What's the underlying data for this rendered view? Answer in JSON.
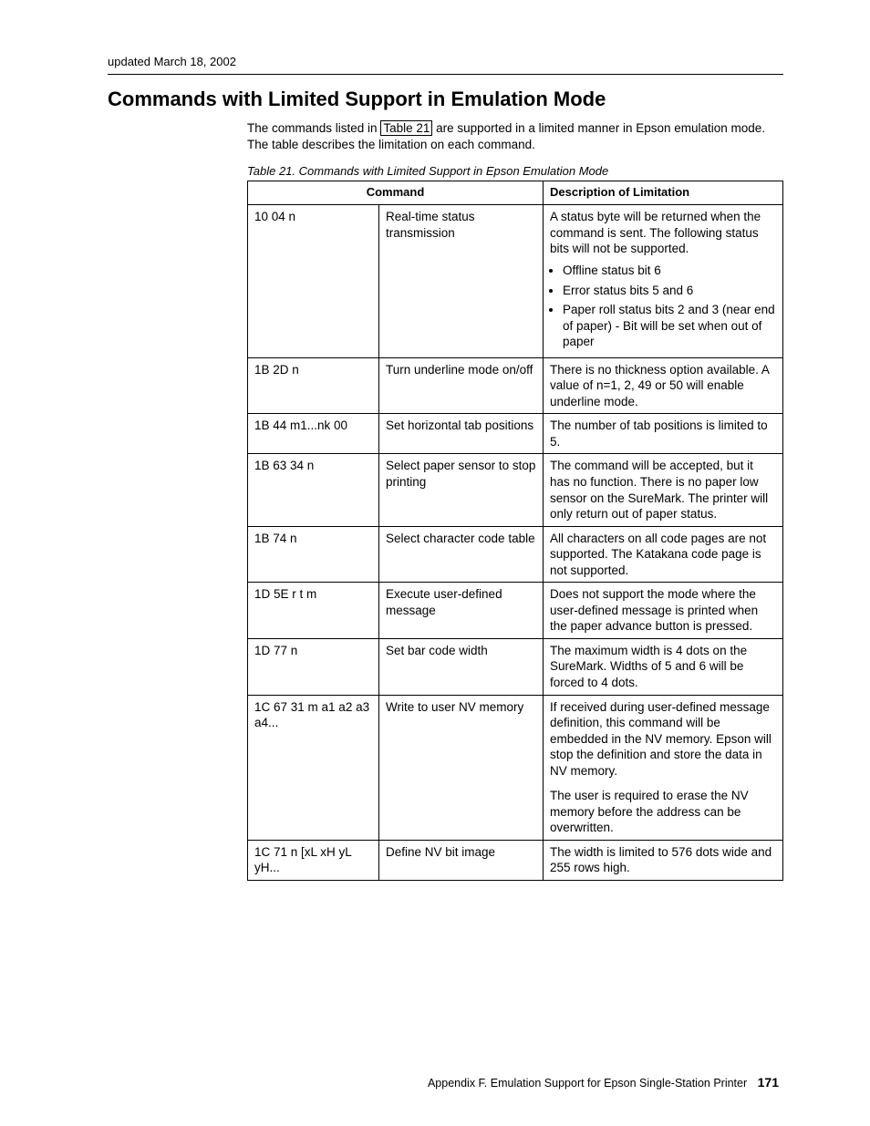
{
  "updated": "updated March 18, 2002",
  "section_title": "Commands with Limited Support in Emulation Mode",
  "intro_pre": "The commands listed in ",
  "intro_ref": "Table 21",
  "intro_post": " are supported in a limited manner in Epson emulation mode. The table describes the limitation on each command.",
  "table_caption": "Table 21. Commands with Limited Support in Epson Emulation Mode",
  "headers": {
    "command": "Command",
    "limitation": "Description of Limitation"
  },
  "rows": [
    {
      "code": "10 04 n",
      "desc": "Real-time status transmission",
      "limit_text": "A status byte will be returned when the command is sent. The following status bits will not be supported.",
      "bullets": [
        "Offline status bit 6",
        "Error status bits 5 and 6",
        "Paper roll status bits 2 and 3 (near end of paper) - Bit will be set when out of paper"
      ]
    },
    {
      "code": "1B 2D n",
      "desc": "Turn underline mode on/off",
      "limit_text": "There is no thickness option available. A value of n=1, 2, 49 or 50 will enable underline mode."
    },
    {
      "code": "1B 44 m1...nk 00",
      "desc": "Set horizontal tab positions",
      "limit_text": "The number of tab positions is limited to 5."
    },
    {
      "code": "1B 63 34 n",
      "desc": "Select paper sensor to stop printing",
      "limit_text": "The command will be accepted, but it has no function. There is no paper low sensor on the SureMark. The printer will only return out of paper status."
    },
    {
      "code": "1B 74 n",
      "desc": "Select character code table",
      "limit_text": "All characters on all code pages are not supported. The Katakana code page is not supported."
    },
    {
      "code": "1D 5E r t m",
      "desc": "Execute user-defined message",
      "limit_text": "Does not support the mode where the user-defined message is printed when the paper advance button is pressed."
    },
    {
      "code": "1D 77 n",
      "desc": "Set bar code width",
      "limit_text": "The maximum width is 4 dots on the SureMark. Widths of 5 and 6 will be forced to 4 dots."
    },
    {
      "code": "1C 67 31 m a1 a2 a3 a4...",
      "desc": "Write to user NV memory",
      "limit_text": "If received during user-defined message definition, this command will be embedded in the NV memory. Epson will stop the definition and store the data in NV memory.",
      "limit_text2": "The user is required to erase the NV memory before the address can be overwritten."
    },
    {
      "code": "1C 71 n [xL xH yL yH...",
      "desc": "Define NV bit image",
      "limit_text": "The width is limited to 576 dots wide and 255 rows high."
    }
  ],
  "footer": {
    "text": "Appendix F. Emulation Support for Epson Single-Station Printer",
    "page": "171"
  }
}
